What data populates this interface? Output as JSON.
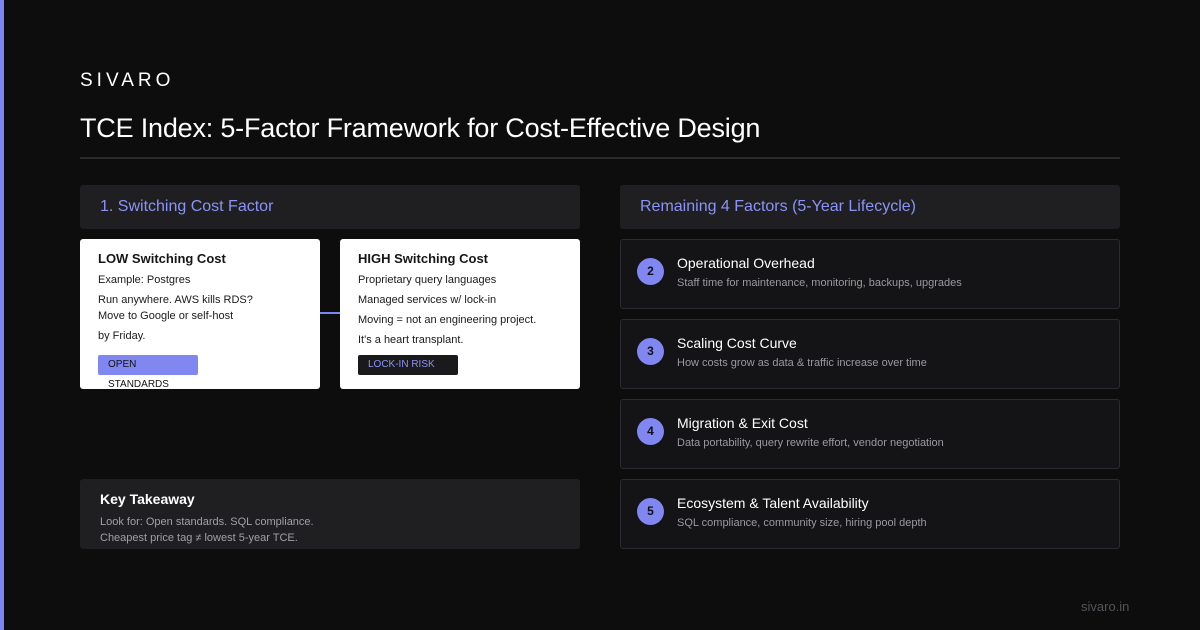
{
  "brand": "SIVARO",
  "title": "TCE Index: 5-Factor Framework for Cost-Effective Design",
  "accent_color": "#7b85f5",
  "left_panel": {
    "header": "1. Switching Cost Factor",
    "low_card": {
      "title": "LOW Switching Cost",
      "lines": [
        "Example: Postgres",
        "Run anywhere. AWS kills RDS?",
        "Move to Google or self-host",
        "by Friday."
      ],
      "tag": "OPEN STANDARDS"
    },
    "high_card": {
      "title": "HIGH Switching Cost",
      "lines": [
        "Proprietary query languages",
        "Managed services w/ lock-in",
        "Moving = not an engineering project.",
        "It's a heart transplant."
      ],
      "tag": "LOCK-IN RISK"
    },
    "takeaway": {
      "title": "Key Takeaway",
      "lines": [
        "Look for: Open standards. SQL compliance.",
        "Cheapest price tag ≠ lowest 5-year TCE."
      ]
    }
  },
  "right_panel": {
    "header": "Remaining 4 Factors (5-Year Lifecycle)",
    "factors": [
      {
        "num": "2",
        "title": "Operational Overhead",
        "desc": "Staff time for maintenance, monitoring, backups, upgrades"
      },
      {
        "num": "3",
        "title": "Scaling Cost Curve",
        "desc": "How costs grow as data & traffic increase over time"
      },
      {
        "num": "4",
        "title": "Migration & Exit Cost",
        "desc": "Data portability, query rewrite effort, vendor negotiation"
      },
      {
        "num": "5",
        "title": "Ecosystem & Talent Availability",
        "desc": "SQL compliance, community size, hiring pool depth"
      }
    ]
  },
  "footer": "sivaro.in"
}
